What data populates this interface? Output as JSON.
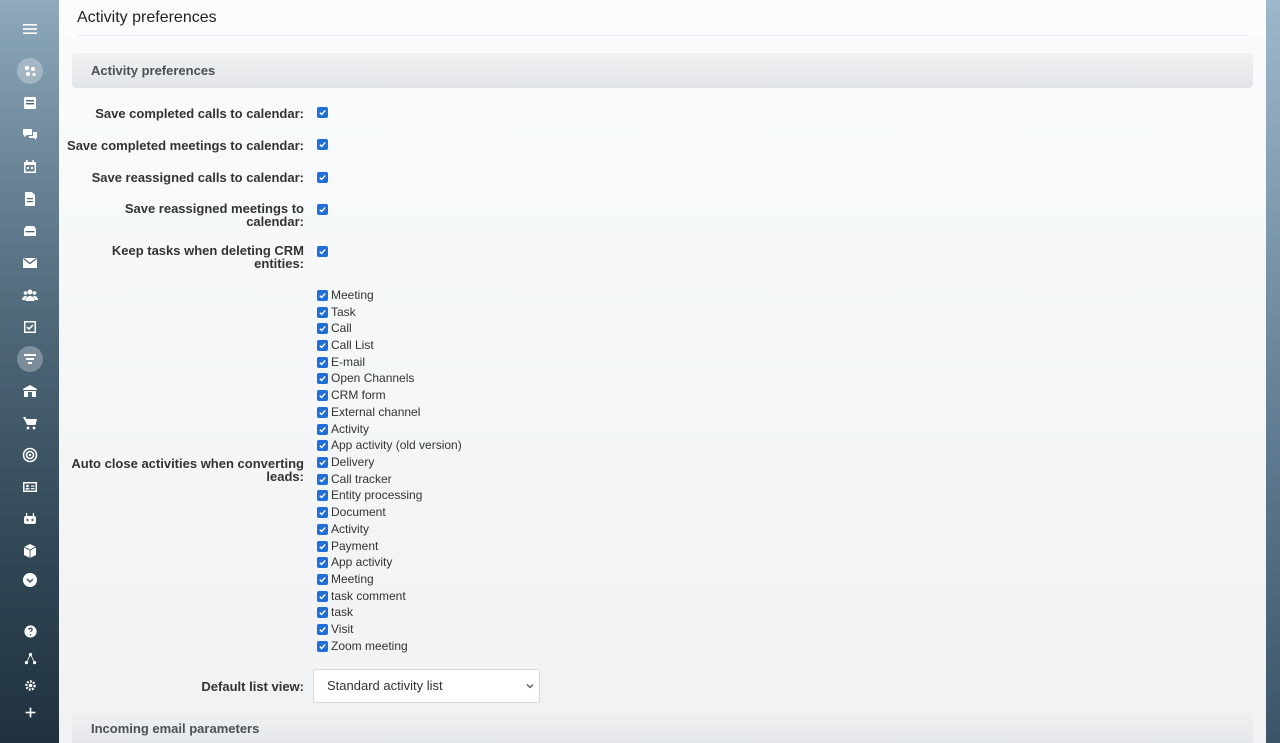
{
  "page": {
    "title": "Activity preferences"
  },
  "sections": {
    "activity_header": "Activity preferences",
    "incoming_header": "Incoming email parameters"
  },
  "settings": [
    {
      "label": "Save completed calls to calendar:",
      "checked": true
    },
    {
      "label": "Save completed meetings to calendar:",
      "checked": true
    },
    {
      "label": "Save reassigned calls to calendar:",
      "checked": true
    },
    {
      "label": "Save reassigned meetings to calendar:",
      "checked": true
    },
    {
      "label": "Keep tasks when deleting CRM entities:",
      "checked": true
    }
  ],
  "auto_close": {
    "label": "Auto close activities when converting leads:",
    "options": [
      {
        "label": "Meeting",
        "checked": true
      },
      {
        "label": "Task",
        "checked": true
      },
      {
        "label": "Call",
        "checked": true
      },
      {
        "label": "Call List",
        "checked": true
      },
      {
        "label": "E-mail",
        "checked": true
      },
      {
        "label": "Open Channels",
        "checked": true
      },
      {
        "label": "CRM form",
        "checked": true
      },
      {
        "label": "External channel",
        "checked": true
      },
      {
        "label": "Activity",
        "checked": true
      },
      {
        "label": "App activity (old version)",
        "checked": true
      },
      {
        "label": "Delivery",
        "checked": true
      },
      {
        "label": "Call tracker",
        "checked": true
      },
      {
        "label": "Entity processing",
        "checked": true
      },
      {
        "label": "Document",
        "checked": true
      },
      {
        "label": "Activity",
        "checked": true
      },
      {
        "label": "Payment",
        "checked": true
      },
      {
        "label": "App activity",
        "checked": true
      },
      {
        "label": "Meeting",
        "checked": true
      },
      {
        "label": "task comment",
        "checked": true
      },
      {
        "label": "task",
        "checked": true
      },
      {
        "label": "Visit",
        "checked": true
      },
      {
        "label": "Zoom meeting",
        "checked": true
      }
    ]
  },
  "default_list_view": {
    "label": "Default list view:",
    "selected": "Standard activity list"
  },
  "sidebar_icons": [
    "menu-icon",
    "sites-icon",
    "feed-icon",
    "chat-icon",
    "calendar-icon",
    "document-icon",
    "drive-icon",
    "mail-icon",
    "employees-icon",
    "tasks-icon",
    "crm-icon",
    "company-icon",
    "shop-icon",
    "target-icon",
    "contact-card-icon",
    "robot-icon",
    "box-icon",
    "more-icon",
    "help-icon",
    "network-icon",
    "settings-icon",
    "add-icon"
  ],
  "colors": {
    "checkbox": "#1f6fd6",
    "section_header_bg": "#e8ebed",
    "title_text": "#222222"
  }
}
